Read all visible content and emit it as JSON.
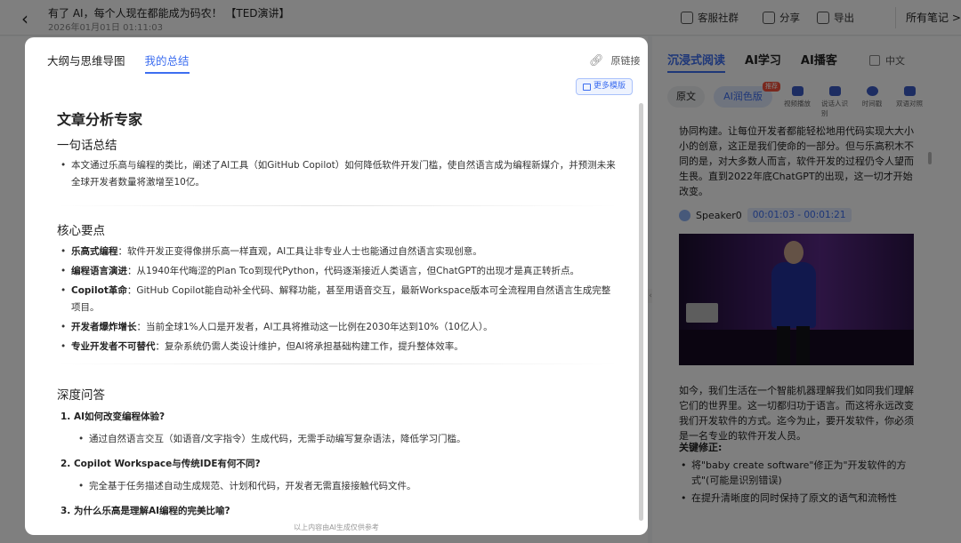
{
  "topbar": {
    "title": "有了 AI，每个人现在都能成为码农！ 【TED演讲】",
    "time": "2026年01月01日 01:11:03",
    "community": "客服社群",
    "share": "分享",
    "export": "导出",
    "all_notes": "所有笔记",
    "chevron": ">"
  },
  "right_panel": {
    "tabs": [
      "沉浸式阅读",
      "AI学习",
      "AI播客"
    ],
    "language": "中文",
    "seg_original": "原文",
    "seg_ai": "AI润色版",
    "new_badge": "推荐",
    "tools": [
      "视频播放",
      "说话人识别",
      "时间戳",
      "双语对照"
    ],
    "para1": "协同构建。让每位开发者都能轻松地用代码实现大大小小的创意，这正是我们使命的一部分。但与乐高积木不同的是，对大多数人而言，软件开发的过程仍令人望而生畏。直到2022年底ChatGPT的出现，这一切才开始改变。",
    "speaker": "Speaker0",
    "speaker_time": "00:01:03 - 00:01:21",
    "para2": "如今，我们生活在一个智能机器理解我们如同我们理解它们的世界里。这一切都归功于语言。而这将永远改变我们开发软件的方式。迄今为止，要开发软件，你必须是一名专业的软件开发人员。",
    "key_fix": "关键修正:",
    "fixes": [
      "将\"baby create software\"修正为\"开发软件的方式\"(可能是识别错误)",
      "在提升清晰度的同时保持了原文的语气和流畅性"
    ]
  },
  "modal": {
    "tabs": [
      "大纲与思维导图",
      "我的总结"
    ],
    "link": "原链接",
    "more_templates": "更多模版",
    "footer": "以上内容由AI生成仅供参考",
    "article_title": "文章分析专家",
    "summary_heading": "一句话总结",
    "summary": "本文通过乐高与编程的类比，阐述了AI工具（如GitHub Copilot）如何降低软件开发门槛，使自然语言成为编程新媒介，并预测未来全球开发者数量将激增至10亿。",
    "points_heading": "核心要点",
    "points": [
      {
        "label": "乐高式编程",
        "text": "：软件开发正变得像拼乐高一样直观，AI工具让非专业人士也能通过自然语言实现创意。"
      },
      {
        "label": "编程语言演进",
        "text": "：从1940年代晦涩的Plan Tco到现代Python，代码逐渐接近人类语言，但ChatGPT的出现才是真正转折点。"
      },
      {
        "label": "Copilot革命",
        "text": "：GitHub Copilot能自动补全代码、解释功能，甚至用语音交互，最新Workspace版本可全流程用自然语言生成完整项目。"
      },
      {
        "label": "开发者爆炸增长",
        "text": "：当前全球1%人口是开发者，AI工具将推动这一比例在2030年达到10%（10亿人）。"
      },
      {
        "label": "专业开发者不可替代",
        "text": "：复杂系统仍需人类设计维护，但AI将承担基础构建工作，提升整体效率。"
      }
    ],
    "qa_heading": "深度问答",
    "qa": [
      {
        "q": "1. AI如何改变编程体验?",
        "a": "通过自然语言交互（如语音/文字指令）生成代码，无需手动编写复杂语法，降低学习门槛。"
      },
      {
        "q": "2. Copilot Workspace与传统IDE有何不同?",
        "a": "完全基于任务描述自动生成规范、计划和代码，开发者无需直接接触代码文件。"
      },
      {
        "q": "3. 为什么乐高是理解AI编程的完美比喻?",
        "a": ""
      }
    ]
  }
}
